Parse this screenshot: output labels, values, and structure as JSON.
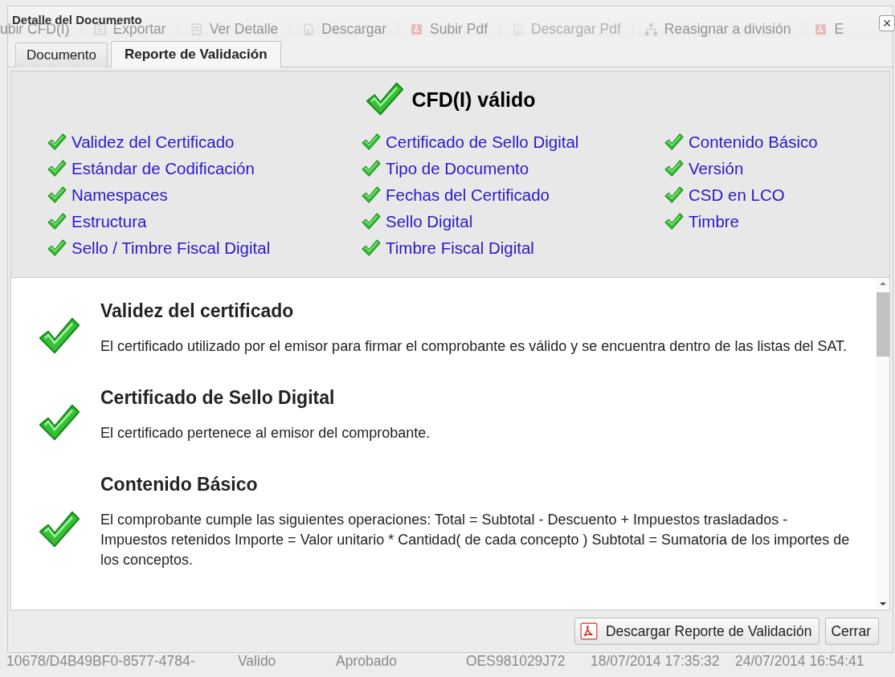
{
  "background_toolbar": [
    {
      "label": "ubir CFD(I)",
      "kind": "plain",
      "disabled": false
    },
    {
      "label": "Exportar",
      "kind": "sheet",
      "disabled": false
    },
    {
      "label": "Ver Detalle",
      "kind": "doc",
      "disabled": false
    },
    {
      "label": "Descargar",
      "kind": "download",
      "disabled": false
    },
    {
      "label": "Subir Pdf",
      "kind": "pdf",
      "disabled": false
    },
    {
      "label": "Descargar Pdf",
      "kind": "download",
      "disabled": true
    },
    {
      "label": "Reasignar a división",
      "kind": "network",
      "disabled": false
    },
    {
      "label": "E",
      "kind": "pdf",
      "disabled": false
    }
  ],
  "background_row": [
    "10678/D4B49BF0-8577-4784-",
    "Valido",
    "Aprobado",
    "OES981029J72",
    "18/07/2014 17:35:32",
    "24/07/2014 16:54:41"
  ],
  "window": {
    "title": "Detalle del Documento",
    "close": "×"
  },
  "tabs": [
    {
      "label": "Documento",
      "selected": false
    },
    {
      "label": "Reporte de Validación",
      "selected": true
    }
  ],
  "summary": {
    "status": "CFD(I) válido",
    "valid": true,
    "checks": [
      {
        "label": "Validez del Certificado",
        "passed": true
      },
      {
        "label": "Certificado de Sello Digital",
        "passed": true
      },
      {
        "label": "Contenido Básico",
        "passed": true
      },
      {
        "label": "Estándar de Codificación",
        "passed": true
      },
      {
        "label": "Tipo de Documento",
        "passed": true
      },
      {
        "label": "Versión",
        "passed": true
      },
      {
        "label": "Namespaces",
        "passed": true
      },
      {
        "label": "Fechas del Certificado",
        "passed": true
      },
      {
        "label": "CSD en LCO",
        "passed": true
      },
      {
        "label": "Estructura",
        "passed": true
      },
      {
        "label": "Sello Digital",
        "passed": true
      },
      {
        "label": "Timbre",
        "passed": true
      },
      {
        "label": "Sello / Timbre Fiscal Digital",
        "passed": true
      },
      {
        "label": "Timbre Fiscal Digital",
        "passed": true
      }
    ]
  },
  "details": [
    {
      "title": "Validez del certificado",
      "description": "El certificado utilizado por el emisor para firmar el comprobante es válido y se encuentra dentro de las listas del SAT.",
      "passed": true
    },
    {
      "title": "Certificado de Sello Digital",
      "description": "El certificado pertenece al emisor del comprobante.",
      "passed": true
    },
    {
      "title": "Contenido Básico",
      "description": "El comprobante cumple las siguientes operaciones: Total = Subtotal - Descuento + Impuestos trasladados - Impuestos retenidos Importe = Valor unitario * Cantidad( de cada concepto ) Subtotal = Sumatoria de los importes de los conceptos.",
      "passed": true
    }
  ],
  "buttons": [
    {
      "label": "Descargar Reporte de Validación",
      "kind": "download"
    },
    {
      "label": "Cerrar",
      "kind": "close"
    }
  ]
}
